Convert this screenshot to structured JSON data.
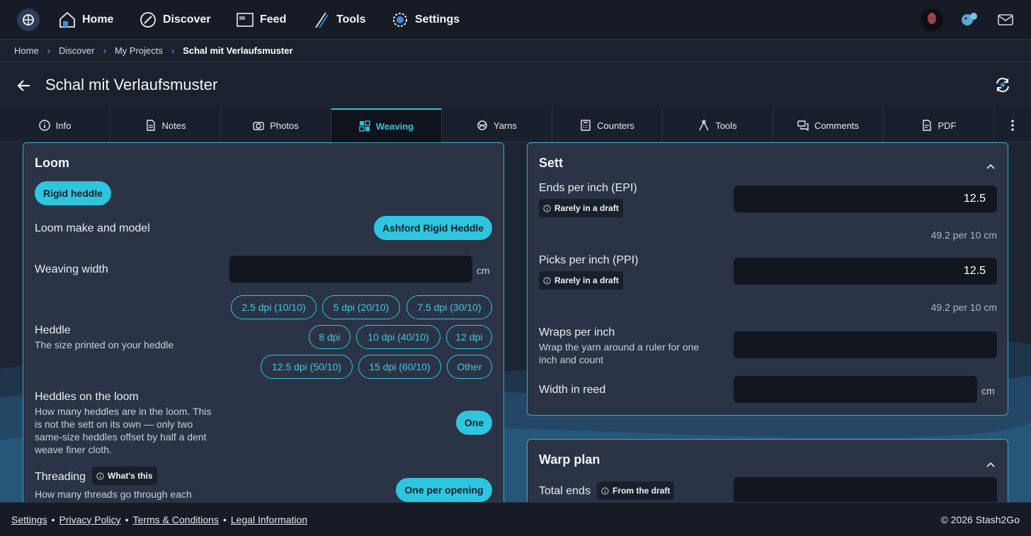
{
  "nav": {
    "logo": "stash2go-logo-icon",
    "items": [
      {
        "label": "Home",
        "icon": "home-icon"
      },
      {
        "label": "Discover",
        "icon": "compass-icon"
      },
      {
        "label": "Feed",
        "icon": "feed-icon"
      },
      {
        "label": "Tools",
        "icon": "needles-icon"
      },
      {
        "label": "Settings",
        "icon": "gear-icon"
      }
    ],
    "right_icons": [
      "avatar-icon",
      "squirrel-icon",
      "mail-icon"
    ]
  },
  "breadcrumb": [
    "Home",
    "Discover",
    "My Projects",
    "Schal mit Verlaufsmuster"
  ],
  "page": {
    "title": "Schal mit Verlaufsmuster"
  },
  "tabs": [
    {
      "label": "Info",
      "icon": "info-icon"
    },
    {
      "label": "Notes",
      "icon": "document-icon"
    },
    {
      "label": "Photos",
      "icon": "camera-icon"
    },
    {
      "label": "Weaving",
      "icon": "grid-icon",
      "active": true
    },
    {
      "label": "Yarns",
      "icon": "yarn-icon"
    },
    {
      "label": "Counters",
      "icon": "calculator-icon"
    },
    {
      "label": "Tools",
      "icon": "tools-icon"
    },
    {
      "label": "Comments",
      "icon": "comments-icon"
    },
    {
      "label": "PDF",
      "icon": "pdf-icon"
    }
  ],
  "loom": {
    "title": "Loom",
    "type_chip": "Rigid heddle",
    "make_label": "Loom make and model",
    "make_value": "Ashford Rigid Heddle",
    "width_label": "Weaving width",
    "width_value": "",
    "width_unit": "cm",
    "heddle_label": "Heddle",
    "heddle_sub": "The size printed on your heddle",
    "heddle_options": [
      "2.5 dpi (10/10)",
      "5 dpi (20/10)",
      "7.5 dpi (30/10)",
      "8 dpi",
      "10 dpi (40/10)",
      "12 dpi",
      "12.5 dpi (50/10)",
      "15 dpi (60/10)",
      "Other"
    ],
    "heddles_label": "Heddles on the loom",
    "heddles_sub": [
      "How many heddles are in the loom. This",
      "is not the sett on its own — only two",
      "same-size heddles offset by half a dent",
      "weave finer cloth."
    ],
    "heddles_value": "One",
    "threading_label": "Threading",
    "threading_tag": "What's this",
    "threading_sub": "How many threads go through each",
    "threading_value": "One per opening"
  },
  "sett": {
    "title": "Sett",
    "epi_label": "Ends per inch (EPI)",
    "epi_tag": "Rarely in a draft",
    "epi_value": "12.5",
    "epi_hint": "49.2 per 10 cm",
    "ppi_label": "Picks per inch (PPI)",
    "ppi_tag": "Rarely in a draft",
    "ppi_value": "12.5",
    "ppi_hint": "49.2 per 10 cm",
    "wpi_label": "Wraps per inch",
    "wpi_sub": [
      "Wrap the yarn around a ruler for one",
      "inch and count"
    ],
    "wpi_value": "",
    "reed_label": "Width in reed",
    "reed_value": "",
    "reed_unit": "cm"
  },
  "warp": {
    "title": "Warp plan",
    "ends_label": "Total ends",
    "ends_tag": "From the draft",
    "ends_value": ""
  },
  "footer": {
    "links": [
      "Settings",
      "Privacy Policy",
      "Terms & Conditions",
      "Legal Information"
    ],
    "separator": "•",
    "copyright": "© 2026 Stash2Go"
  },
  "colors": {
    "accent": "#2ec6df",
    "background": "#1e2532",
    "card": "#2a3446",
    "input": "#12161f"
  }
}
